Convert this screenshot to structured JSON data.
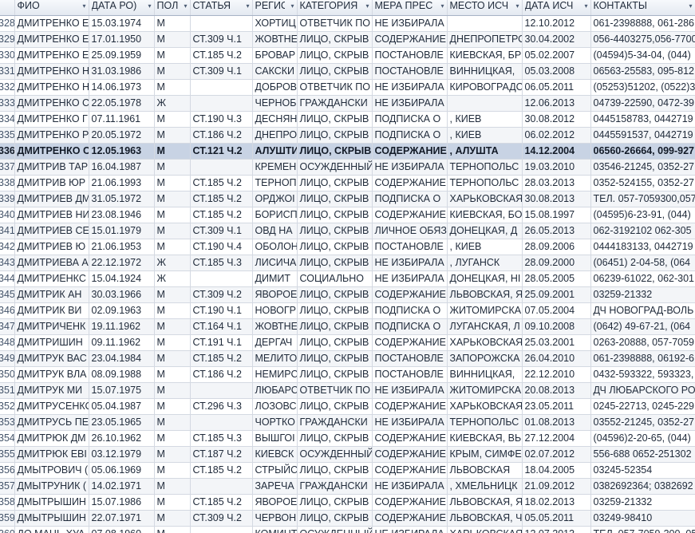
{
  "columns": [
    {
      "key": "id",
      "label": "",
      "width": 18
    },
    {
      "key": "fio",
      "label": "ФИО",
      "width": 93
    },
    {
      "key": "dob",
      "label": "ДАТА РО)",
      "width": 82
    },
    {
      "key": "sex",
      "label": "ПОЛ",
      "width": 45
    },
    {
      "key": "article",
      "label": "СТАТЬЯ",
      "width": 78
    },
    {
      "key": "region",
      "label": "РЕГИС",
      "width": 56
    },
    {
      "key": "category",
      "label": "КАТЕГОРИЯ",
      "width": 94
    },
    {
      "key": "measure",
      "label": "МЕРА ПРЕС",
      "width": 94
    },
    {
      "key": "place",
      "label": "МЕСТО ИСЧ",
      "width": 94
    },
    {
      "key": "date",
      "label": "ДАТА ИСЧ",
      "width": 86
    },
    {
      "key": "contacts",
      "label": "КОНТАКТЫ",
      "width": 131
    }
  ],
  "rows": [
    {
      "id": "328",
      "fio": "ДМИТРЕНКО Е",
      "dob": "15.03.1974",
      "sex": "М",
      "article": "",
      "region": "ХОРТИЦ",
      "category": "ОТВЕТЧИК ПО",
      "measure": "НЕ ИЗБИРАЛА",
      "place": "",
      "date": "12.10.2012",
      "contacts": "061-2398888, 061-286"
    },
    {
      "id": "329",
      "fio": "ДМИТРЕНКО Е",
      "dob": "17.01.1950",
      "sex": "М",
      "article": "СТ.309 Ч.1",
      "region": "ЖОВТНЕ",
      "category": "ЛИЦО, СКРЫВ",
      "measure": "СОДЕРЖАНИЕ",
      "place": "ДНЕПРОПЕТРО",
      "date": "30.04.2002",
      "contacts": "056-4403275,056-7700"
    },
    {
      "id": "330",
      "fio": "ДМИТРЕНКО Е",
      "dob": "25.09.1959",
      "sex": "М",
      "article": "СТ.185 Ч.2",
      "region": "БРОВАР",
      "category": "ЛИЦО, СКРЫВ",
      "measure": "ПОСТАНОВЛЕ",
      "place": "КИЕВСКАЯ, БР",
      "date": "05.02.2007",
      "contacts": "(04594)5-34-04, (044)"
    },
    {
      "id": "331",
      "fio": "ДМИТРЕНКО Н",
      "dob": "31.03.1986",
      "sex": "М",
      "article": "СТ.309 Ч.1",
      "region": "САКСКИ",
      "category": "ЛИЦО, СКРЫВ",
      "measure": "ПОСТАНОВЛЕ",
      "place": "ВИННИЦКАЯ,",
      "date": "05.03.2008",
      "contacts": "06563-25583, 095-812"
    },
    {
      "id": "332",
      "fio": "ДМИТРЕНКО Н",
      "dob": "14.06.1973",
      "sex": "М",
      "article": "",
      "region": "ДОБРОВ",
      "category": "ОТВЕТЧИК ПО",
      "measure": "НЕ ИЗБИРАЛА",
      "place": "КИРОВОГРАДС",
      "date": "06.05.2011",
      "contacts": "(05253)51202, (0522)3"
    },
    {
      "id": "333",
      "fio": "ДМИТРЕНКО С",
      "dob": "22.05.1978",
      "sex": "Ж",
      "article": "",
      "region": "ЧЕРНОБ",
      "category": "ГРАЖДАНСКИ",
      "measure": "НЕ ИЗБИРАЛА",
      "place": "",
      "date": "12.06.2013",
      "contacts": "04739-22590, 0472-39"
    },
    {
      "id": "334",
      "fio": "ДМИТРЕНКО Г",
      "dob": "07.11.1961",
      "sex": "М",
      "article": "СТ.190 Ч.3",
      "region": "ДЕСНЯН",
      "category": "ЛИЦО, СКРЫВ",
      "measure": "ПОДПИСКА О",
      "place": ", КИЕВ",
      "date": "30.08.2012",
      "contacts": "0445158783, 0442719"
    },
    {
      "id": "335",
      "fio": "ДМИТРЕНКО Р",
      "dob": "20.05.1972",
      "sex": "М",
      "article": "СТ.186 Ч.2",
      "region": "ДНЕПРО",
      "category": "ЛИЦО, СКРЫВ",
      "measure": "ПОДПИСКА О",
      "place": ", КИЕВ",
      "date": "06.02.2012",
      "contacts": "0445591537, 0442719"
    },
    {
      "id": "336",
      "fio": "ДМИТРЕНКО С",
      "dob": "12.05.1963",
      "sex": "М",
      "article": "СТ.121 Ч.2",
      "region": "АЛУШТИ",
      "category": "ЛИЦО, СКРЫВ",
      "measure": "СОДЕРЖАНИЕ",
      "place": ", АЛУШТА",
      "date": "14.12.2004",
      "contacts": "06560-26664, 099-927",
      "selected": true
    },
    {
      "id": "337",
      "fio": "ДМИТРИВ ТАР",
      "dob": "16.04.1987",
      "sex": "М",
      "article": "",
      "region": "КРЕМЕН",
      "category": "ОСУЖДЕННЫЙ",
      "measure": "НЕ ИЗБИРАЛА",
      "place": "ТЕРНОПОЛЬС",
      "date": "19.03.2010",
      "contacts": "03546-21245, 0352-27"
    },
    {
      "id": "338",
      "fio": "ДМИТРИВ ЮР",
      "dob": "21.06.1993",
      "sex": "М",
      "article": "СТ.185 Ч.2",
      "region": "ТЕРНОП",
      "category": "ЛИЦО, СКРЫВ",
      "measure": "СОДЕРЖАНИЕ",
      "place": "ТЕРНОПОЛЬС",
      "date": "28.03.2013",
      "contacts": "0352-524155, 0352-27"
    },
    {
      "id": "339",
      "fio": "ДМИТРИЕВ ДМ",
      "dob": "31.05.1972",
      "sex": "М",
      "article": "СТ.185 Ч.2",
      "region": "ОРДЖОІ",
      "category": "ЛИЦО, СКРЫВ",
      "measure": "ПОДПИСКА О",
      "place": "ХАРЬКОВСКАЯ",
      "date": "30.08.2013",
      "contacts": "ТЕЛ. 057-7059300,057"
    },
    {
      "id": "340",
      "fio": "ДМИТРИЕВ НИ",
      "dob": "23.08.1946",
      "sex": "М",
      "article": "СТ.185 Ч.2",
      "region": "БОРИСП",
      "category": "ЛИЦО, СКРЫВ",
      "measure": "СОДЕРЖАНИЕ",
      "place": "КИЕВСКАЯ, БО",
      "date": "15.08.1997",
      "contacts": "(04595)6-23-91, (044)"
    },
    {
      "id": "341",
      "fio": "ДМИТРИЕВ СЕ",
      "dob": "15.01.1979",
      "sex": "М",
      "article": "СТ.309 Ч.1",
      "region": "ОВД НА",
      "category": "ЛИЦО, СКРЫВ",
      "measure": "ЛИЧНОЕ ОБЯЗ",
      "place": "ДОНЕЦКАЯ, Д",
      "date": "26.05.2013",
      "contacts": "062-3192102 062-305"
    },
    {
      "id": "342",
      "fio": "ДМИТРИЕВ Ю",
      "dob": "21.06.1953",
      "sex": "М",
      "article": "СТ.190 Ч.4",
      "region": "ОБОЛОН",
      "category": "ЛИЦО, СКРЫВ",
      "measure": "ПОСТАНОВЛЕ",
      "place": ", КИЕВ",
      "date": "28.09.2006",
      "contacts": "0444183133, 0442719"
    },
    {
      "id": "343",
      "fio": "ДМИТРИЕВА А",
      "dob": "22.12.1972",
      "sex": "Ж",
      "article": "СТ.185 Ч.3",
      "region": "ЛИСИЧА",
      "category": "ЛИЦО, СКРЫВ",
      "measure": "НЕ ИЗБИРАЛА",
      "place": ", ЛУГАНСК",
      "date": "28.09.2000",
      "contacts": "(06451) 2-04-58, (064"
    },
    {
      "id": "344",
      "fio": "ДМИТРИЕНКС",
      "dob": "15.04.1924",
      "sex": "Ж",
      "article": "",
      "region": "ДИМИТ",
      "category": "СОЦИАЛЬНО",
      "measure": "НЕ ИЗБИРАЛА",
      "place": "ДОНЕЦКАЯ, НІ",
      "date": "28.05.2005",
      "contacts": "06239-61022, 062-301"
    },
    {
      "id": "345",
      "fio": "ДМИТРИК АН",
      "dob": "30.03.1966",
      "sex": "М",
      "article": "СТ.309 Ч.2",
      "region": "ЯВОРОЕ",
      "category": "ЛИЦО, СКРЫВ",
      "measure": "СОДЕРЖАНИЕ",
      "place": "ЛЬВОВСКАЯ, Я",
      "date": "25.09.2001",
      "contacts": "03259-21332"
    },
    {
      "id": "346",
      "fio": "ДМИТРИК ВИ",
      "dob": "02.09.1963",
      "sex": "М",
      "article": "СТ.190 Ч.1",
      "region": "НОВОГР",
      "category": "ЛИЦО, СКРЫВ",
      "measure": "ПОДПИСКА О",
      "place": "ЖИТОМИРСКА",
      "date": "07.05.2004",
      "contacts": "ДЧ НОВОГРАД-ВОЛЬ"
    },
    {
      "id": "347",
      "fio": "ДМИТРИЧЕНК",
      "dob": "19.11.1962",
      "sex": "М",
      "article": "СТ.164 Ч.1",
      "region": "ЖОВТНЕ",
      "category": "ЛИЦО, СКРЫВ",
      "measure": "ПОДПИСКА О",
      "place": "ЛУГАНСКАЯ, Л",
      "date": "09.10.2008",
      "contacts": "(0642) 49-67-21, (064"
    },
    {
      "id": "348",
      "fio": "ДМИТРИШИН",
      "dob": "09.11.1962",
      "sex": "М",
      "article": "СТ.191 Ч.1",
      "region": "ДЕРГАЧ",
      "category": "ЛИЦО, СКРЫВ",
      "measure": "СОДЕРЖАНИЕ",
      "place": "ХАРЬКОВСКАЯ",
      "date": "25.03.2001",
      "contacts": "0263-20888, 057-7059"
    },
    {
      "id": "349",
      "fio": "ДМИТРУК ВАС",
      "dob": "23.04.1984",
      "sex": "М",
      "article": "СТ.185 Ч.2",
      "region": "МЕЛИТО",
      "category": "ЛИЦО, СКРЫВ",
      "measure": "ПОСТАНОВЛЕ",
      "place": "ЗАПОРОЖСКА",
      "date": "26.04.2010",
      "contacts": "061-2398888, 06192-6"
    },
    {
      "id": "350",
      "fio": "ДМИТРУК ВЛА",
      "dob": "08.09.1988",
      "sex": "М",
      "article": "СТ.186 Ч.2",
      "region": "НЕМИРС",
      "category": "ЛИЦО, СКРЫВ",
      "measure": "ПОСТАНОВЛЕ",
      "place": "ВИННИЦКАЯ,",
      "date": "22.12.2010",
      "contacts": "0432-593322, 593323,"
    },
    {
      "id": "351",
      "fio": "ДМИТРУК МИ",
      "dob": "15.07.1975",
      "sex": "М",
      "article": "",
      "region": "ЛЮБАРС",
      "category": "ОТВЕТЧИК ПО",
      "measure": "НЕ ИЗБИРАЛА",
      "place": "ЖИТОМИРСКА",
      "date": "20.08.2013",
      "contacts": "ДЧ ЛЮБАРСКОГО РО"
    },
    {
      "id": "352",
      "fio": "ДМИТРУСЕНКС",
      "dob": "05.04.1987",
      "sex": "М",
      "article": "СТ.296 Ч.3",
      "region": "ЛОЗОВС",
      "category": "ЛИЦО, СКРЫВ",
      "measure": "СОДЕРЖАНИЕ",
      "place": "ХАРЬКОВСКАЯ",
      "date": "23.05.2011",
      "contacts": "0245-22713, 0245-229"
    },
    {
      "id": "353",
      "fio": "ДМИТРУСЬ ПЕ",
      "dob": "23.05.1965",
      "sex": "М",
      "article": "",
      "region": "ЧОРТКО",
      "category": "ГРАЖДАНСКИ",
      "measure": "НЕ ИЗБИРАЛА",
      "place": "ТЕРНОПОЛЬС",
      "date": "01.08.2013",
      "contacts": "03552-21245, 0352-27"
    },
    {
      "id": "354",
      "fio": "ДМИТРЮК ДМ",
      "dob": "26.10.1962",
      "sex": "М",
      "article": "СТ.185 Ч.3",
      "region": "ВЫШГОІ",
      "category": "ЛИЦО, СКРЫВ",
      "measure": "СОДЕРЖАНИЕ",
      "place": "КИЕВСКАЯ, ВЬ",
      "date": "27.12.2004",
      "contacts": "(04596)2-20-65, (044)"
    },
    {
      "id": "355",
      "fio": "ДМИТРЮК ЕВІ",
      "dob": "03.12.1979",
      "sex": "М",
      "article": "СТ.187 Ч.2",
      "region": "КИЕВСК",
      "category": "ОСУЖДЕННЫЙ",
      "measure": "СОДЕРЖАНИЕ",
      "place": "КРЫМ, СИМФЕ",
      "date": "02.07.2012",
      "contacts": "556-688 0652-251302"
    },
    {
      "id": "356",
      "fio": "ДМЫТРОВИЧ (",
      "dob": "05.06.1969",
      "sex": "М",
      "article": "СТ.185 Ч.2",
      "region": "СТРЫЙС",
      "category": "ЛИЦО, СКРЫВ",
      "measure": "СОДЕРЖАНИЕ",
      "place": "ЛЬВОВСКАЯ",
      "date": "18.04.2005",
      "contacts": "03245-52354"
    },
    {
      "id": "357",
      "fio": "ДМЫТРУНИК (",
      "dob": "14.02.1971",
      "sex": "М",
      "article": "",
      "region": "ЗАРЕЧА",
      "category": "ГРАЖДАНСКИ",
      "measure": "НЕ ИЗБИРАЛА",
      "place": ", ХМЕЛЬНИЦК",
      "date": "21.09.2012",
      "contacts": "0382692364; 0382692"
    },
    {
      "id": "358",
      "fio": "ДМЫТРЫШИН",
      "dob": "15.07.1986",
      "sex": "М",
      "article": "СТ.185 Ч.2",
      "region": "ЯВОРОЕ",
      "category": "ЛИЦО, СКРЫВ",
      "measure": "СОДЕРЖАНИЕ",
      "place": "ЛЬВОВСКАЯ, Я",
      "date": "18.02.2013",
      "contacts": "03259-21332"
    },
    {
      "id": "359",
      "fio": "ДМЫТРЫШИН",
      "dob": "22.07.1971",
      "sex": "М",
      "article": "СТ.309 Ч.2",
      "region": "ЧЕРВОН",
      "category": "ЛИЦО, СКРЫВ",
      "measure": "СОДЕРЖАНИЕ",
      "place": "ЛЬВОВСКАЯ, Ч",
      "date": "05.05.2011",
      "contacts": "03249-98410"
    },
    {
      "id": "360",
      "fio": "ДО МАНЬ ХУА",
      "dob": "07.08.1960",
      "sex": "М",
      "article": "",
      "region": "КОМИНТ",
      "category": "ОСУЖДЕННЫЙ",
      "measure": "НЕ ИЗБИРАЛА",
      "place": "ХАРЬКОВСКАЯ",
      "date": "12.07.2013",
      "contacts": "ТЕЛ. 057-7059-300, 05"
    }
  ]
}
